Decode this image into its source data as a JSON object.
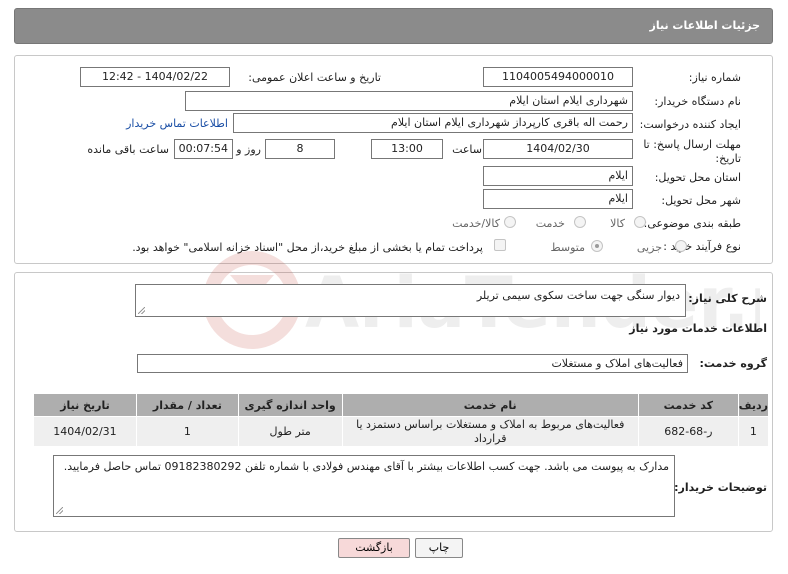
{
  "header": {
    "title": "جزئیات اطلاعات نیاز"
  },
  "form": {
    "need_number": {
      "label": "شماره نیاز:",
      "value": "1104005494000010"
    },
    "announce_datetime": {
      "label": "تاریخ و ساعت اعلان عمومی:",
      "value": "1404/02/22 - 12:42"
    },
    "buyer_org": {
      "label": "نام دستگاه خریدار:",
      "value": "شهرداری ایلام استان ایلام"
    },
    "creator": {
      "label": "ایجاد کننده درخواست:",
      "value": "رحمت اله باقری کارپرداز شهرداری ایلام استان ایلام",
      "contact_link": "اطلاعات تماس خریدار"
    },
    "deadline": {
      "label_line1": "مهلت ارسال پاسخ: تا",
      "label_line2": "تاریخ:",
      "date": "1404/02/30",
      "time_label": "ساعت",
      "time": "13:00",
      "days": "8",
      "days_label": "روز و",
      "remaining": "00:07:54",
      "remaining_label": "ساعت باقی مانده"
    },
    "province": {
      "label": "استان محل تحویل:",
      "value": "ایلام"
    },
    "city": {
      "label": "شهر محل تحویل:",
      "value": "ایلام"
    },
    "category": {
      "label": "طبقه بندی موضوعی:",
      "options": [
        "کالا",
        "خدمت",
        "کالا/خدمت"
      ]
    },
    "process": {
      "label": "نوع فرآیند خرید :",
      "options": [
        "جزیی",
        "متوسط"
      ],
      "payment_note": "پرداخت تمام یا بخشی از مبلغ خرید،از محل \"اسناد خزانه اسلامی\" خواهد بود."
    }
  },
  "summary": {
    "label": "شرح کلی نیاز:",
    "value": "دیوار سنگی جهت ساخت سکوی سیمی تریلر"
  },
  "services": {
    "title": "اطلاعات خدمات مورد نیاز",
    "group_label": "گروه خدمت:",
    "group_value": "فعالیت‌های  املاک و مستغلات",
    "columns": [
      "ردیف",
      "کد خدمت",
      "نام خدمت",
      "واحد اندازه گیری",
      "تعداد / مقدار",
      "تاریخ نیاز"
    ],
    "rows": [
      [
        "1",
        "ر-68-682",
        "فعالیت‌های مربوط به املاک و مستغلات براساس دستمزد یا قرارداد",
        "متر طول",
        "1",
        "1404/02/31"
      ]
    ]
  },
  "buyer_notes": {
    "label": "توضیحات خریدار:",
    "value": "مدارک به پیوست می باشد. جهت کسب اطلاعات بیشتر با آقای مهندس فولادی با شماره تلفن 09182380292 تماس حاصل فرمایید."
  },
  "buttons": {
    "print": "چاپ",
    "back": "بازگشت"
  },
  "watermark": {
    "text": "AriaTender.neT"
  },
  "colors": {
    "header": "#8b8b8b",
    "table_header": "#aeaeae",
    "link": "#1a4ea5",
    "back_button": "#f7d9d9"
  }
}
